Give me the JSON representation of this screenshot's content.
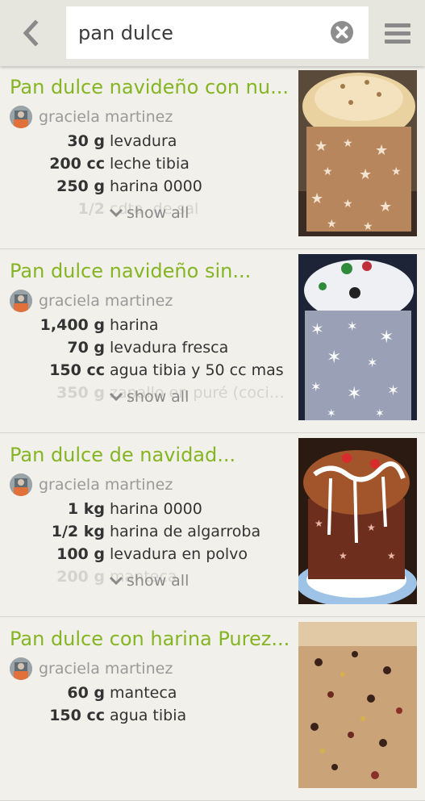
{
  "search": {
    "query": "pan dulce"
  },
  "recipes": [
    {
      "title": "Pan dulce navideño con nu...",
      "author": "graciela martinez",
      "ingredients": [
        {
          "qty": "30 g",
          "name": "levadura"
        },
        {
          "qty": "200 cc",
          "name": "leche tibia"
        },
        {
          "qty": "250 g",
          "name": "harina 0000"
        },
        {
          "qty": "1/2",
          "name": "cdta. de sal"
        }
      ],
      "show_all": "show all"
    },
    {
      "title": "Pan dulce navideño sin...",
      "author": "graciela martinez",
      "ingredients": [
        {
          "qty": "1,400 g",
          "name": "harina"
        },
        {
          "qty": "70 g",
          "name": "levadura fresca"
        },
        {
          "qty": "150 cc",
          "name": "agua tibia y 50 cc mas"
        },
        {
          "qty": "350 g",
          "name": "zapallo en puré (cocin..."
        }
      ],
      "show_all": "show all"
    },
    {
      "title": "Pan dulce de navidad...",
      "author": "graciela martinez",
      "ingredients": [
        {
          "qty": "1 kg",
          "name": "harina 0000"
        },
        {
          "qty": "1/2 kg",
          "name": "harina de algarroba"
        },
        {
          "qty": "100 g",
          "name": "levadura en polvo"
        },
        {
          "qty": "200 g",
          "name": "manteca"
        }
      ],
      "show_all": "show all"
    },
    {
      "title": "Pan dulce con harina Purez...",
      "author": "graciela martinez",
      "ingredients": [
        {
          "qty": "60 g",
          "name": "manteca"
        },
        {
          "qty": "150 cc",
          "name": "agua tibia"
        }
      ],
      "show_all": ""
    }
  ]
}
